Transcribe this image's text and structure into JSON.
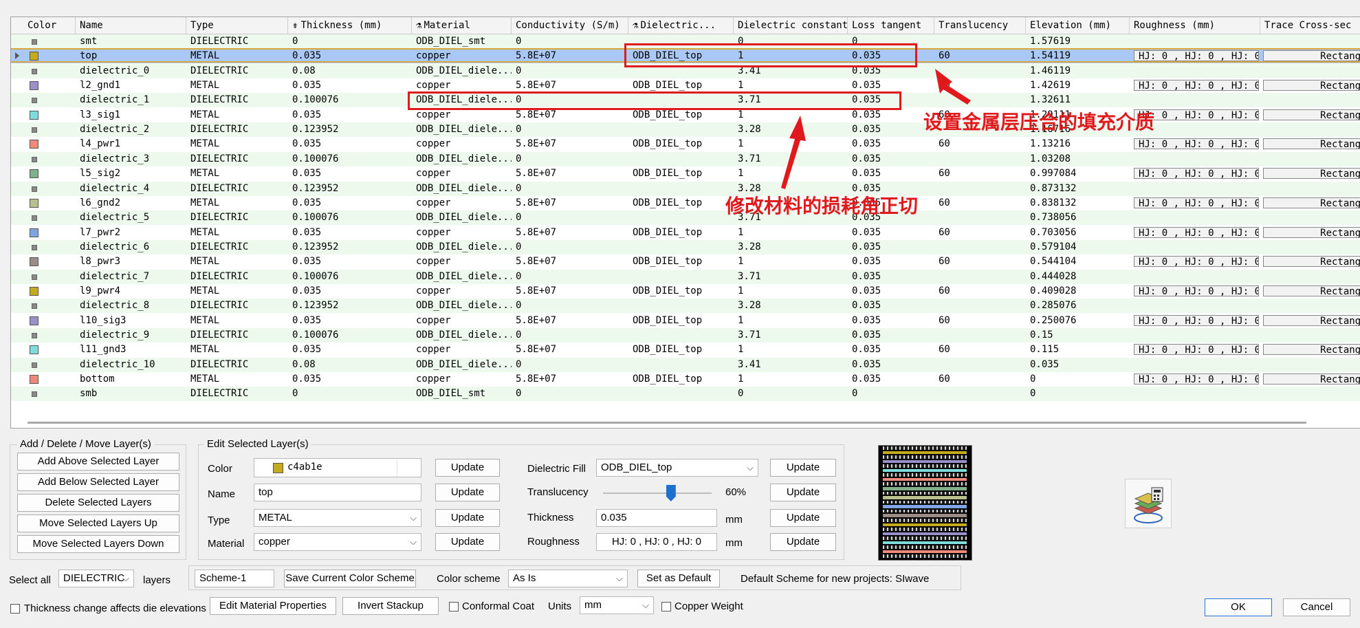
{
  "columns": [
    "Color",
    "Name",
    "Type",
    "Thickness (mm)",
    "Material",
    "Conductivity (S/m)",
    "Dielectric...",
    "Dielectric constant",
    "Loss tangent",
    "Translucency",
    "Elevation (mm)",
    "Roughness (mm)",
    "Trace Cross-sec"
  ],
  "rows": [
    {
      "color": "",
      "name": "smt",
      "type": "DIELECTRIC",
      "thickness": "0",
      "material": "ODB_DIEL_smt",
      "conductivity": "0",
      "fill": "",
      "dk": "0",
      "loss": "0",
      "transl": "",
      "elev": "1.57619",
      "rough": "",
      "trace": ""
    },
    {
      "color": "#c4ab1e",
      "name": "top",
      "type": "METAL",
      "thickness": "0.035",
      "material": "copper",
      "conductivity": "5.8E+07",
      "fill": "ODB_DIEL_top",
      "dk": "1",
      "loss": "0.035",
      "transl": "60",
      "elev": "1.54119",
      "rough": "HJ: 0 , HJ: 0 , HJ: 0",
      "trace": "Rectangle",
      "selected": true
    },
    {
      "color": "",
      "name": "dielectric_0",
      "type": "DIELECTRIC",
      "thickness": "0.08",
      "material": "ODB_DIEL_diele...",
      "conductivity": "0",
      "fill": "",
      "dk": "3.41",
      "loss": "0.035",
      "transl": "",
      "elev": "1.46119",
      "rough": "",
      "trace": ""
    },
    {
      "color": "#9b8fc9",
      "name": "l2_gnd1",
      "type": "METAL",
      "thickness": "0.035",
      "material": "copper",
      "conductivity": "5.8E+07",
      "fill": "ODB_DIEL_top",
      "dk": "1",
      "loss": "0.035",
      "transl": "60",
      "elev": "1.42619",
      "rough": "HJ: 0 , HJ: 0 , HJ: 0",
      "trace": "Rectangle"
    },
    {
      "color": "",
      "name": "dielectric_1",
      "type": "DIELECTRIC",
      "thickness": "0.100076",
      "material": "ODB_DIEL_diele...",
      "conductivity": "0",
      "fill": "",
      "dk": "3.71",
      "loss": "0.035",
      "transl": "",
      "elev": "1.32611",
      "rough": "",
      "trace": ""
    },
    {
      "color": "#7fdcdc",
      "name": "l3_sig1",
      "type": "METAL",
      "thickness": "0.035",
      "material": "copper",
      "conductivity": "5.8E+07",
      "fill": "ODB_DIEL_top",
      "dk": "1",
      "loss": "0.035",
      "transl": "60",
      "elev": "1.29111",
      "rough": "HJ: 0 , HJ: 0 , HJ: 0",
      "trace": "Rectangle"
    },
    {
      "color": "",
      "name": "dielectric_2",
      "type": "DIELECTRIC",
      "thickness": "0.123952",
      "material": "ODB_DIEL_diele...",
      "conductivity": "0",
      "fill": "",
      "dk": "3.28",
      "loss": "0.035",
      "transl": "",
      "elev": "1.16716",
      "rough": "",
      "trace": ""
    },
    {
      "color": "#ef8a7a",
      "name": "l4_pwr1",
      "type": "METAL",
      "thickness": "0.035",
      "material": "copper",
      "conductivity": "5.8E+07",
      "fill": "ODB_DIEL_top",
      "dk": "1",
      "loss": "0.035",
      "transl": "60",
      "elev": "1.13216",
      "rough": "HJ: 0 , HJ: 0 , HJ: 0",
      "trace": "Rectangle"
    },
    {
      "color": "",
      "name": "dielectric_3",
      "type": "DIELECTRIC",
      "thickness": "0.100076",
      "material": "ODB_DIEL_diele...",
      "conductivity": "0",
      "fill": "",
      "dk": "3.71",
      "loss": "0.035",
      "transl": "",
      "elev": "1.03208",
      "rough": "",
      "trace": ""
    },
    {
      "color": "#7fb08a",
      "name": "l5_sig2",
      "type": "METAL",
      "thickness": "0.035",
      "material": "copper",
      "conductivity": "5.8E+07",
      "fill": "ODB_DIEL_top",
      "dk": "1",
      "loss": "0.035",
      "transl": "60",
      "elev": "0.997084",
      "rough": "HJ: 0 , HJ: 0 , HJ: 0",
      "trace": "Rectangle"
    },
    {
      "color": "",
      "name": "dielectric_4",
      "type": "DIELECTRIC",
      "thickness": "0.123952",
      "material": "ODB_DIEL_diele...",
      "conductivity": "0",
      "fill": "",
      "dk": "3.28",
      "loss": "0.035",
      "transl": "",
      "elev": "0.873132",
      "rough": "",
      "trace": ""
    },
    {
      "color": "#b9c08e",
      "name": "l6_gnd2",
      "type": "METAL",
      "thickness": "0.035",
      "material": "copper",
      "conductivity": "5.8E+07",
      "fill": "ODB_DIEL_top",
      "dk": "1",
      "loss": "0.035",
      "transl": "60",
      "elev": "0.838132",
      "rough": "HJ: 0 , HJ: 0 , HJ: 0",
      "trace": "Rectangle"
    },
    {
      "color": "",
      "name": "dielectric_5",
      "type": "DIELECTRIC",
      "thickness": "0.100076",
      "material": "ODB_DIEL_diele...",
      "conductivity": "0",
      "fill": "",
      "dk": "3.71",
      "loss": "0.035",
      "transl": "",
      "elev": "0.738056",
      "rough": "",
      "trace": ""
    },
    {
      "color": "#7fa6e2",
      "name": "l7_pwr2",
      "type": "METAL",
      "thickness": "0.035",
      "material": "copper",
      "conductivity": "5.8E+07",
      "fill": "ODB_DIEL_top",
      "dk": "1",
      "loss": "0.035",
      "transl": "60",
      "elev": "0.703056",
      "rough": "HJ: 0 , HJ: 0 , HJ: 0",
      "trace": "Rectangle"
    },
    {
      "color": "",
      "name": "dielectric_6",
      "type": "DIELECTRIC",
      "thickness": "0.123952",
      "material": "ODB_DIEL_diele...",
      "conductivity": "0",
      "fill": "",
      "dk": "3.28",
      "loss": "0.035",
      "transl": "",
      "elev": "0.579104",
      "rough": "",
      "trace": ""
    },
    {
      "color": "#9c8c88",
      "name": "l8_pwr3",
      "type": "METAL",
      "thickness": "0.035",
      "material": "copper",
      "conductivity": "5.8E+07",
      "fill": "ODB_DIEL_top",
      "dk": "1",
      "loss": "0.035",
      "transl": "60",
      "elev": "0.544104",
      "rough": "HJ: 0 , HJ: 0 , HJ: 0",
      "trace": "Rectangle"
    },
    {
      "color": "",
      "name": "dielectric_7",
      "type": "DIELECTRIC",
      "thickness": "0.100076",
      "material": "ODB_DIEL_diele...",
      "conductivity": "0",
      "fill": "",
      "dk": "3.71",
      "loss": "0.035",
      "transl": "",
      "elev": "0.444028",
      "rough": "",
      "trace": ""
    },
    {
      "color": "#c4ab1e",
      "name": "l9_pwr4",
      "type": "METAL",
      "thickness": "0.035",
      "material": "copper",
      "conductivity": "5.8E+07",
      "fill": "ODB_DIEL_top",
      "dk": "1",
      "loss": "0.035",
      "transl": "60",
      "elev": "0.409028",
      "rough": "HJ: 0 , HJ: 0 , HJ: 0",
      "trace": "Rectangle"
    },
    {
      "color": "",
      "name": "dielectric_8",
      "type": "DIELECTRIC",
      "thickness": "0.123952",
      "material": "ODB_DIEL_diele...",
      "conductivity": "0",
      "fill": "",
      "dk": "3.28",
      "loss": "0.035",
      "transl": "",
      "elev": "0.285076",
      "rough": "",
      "trace": ""
    },
    {
      "color": "#9b8fc9",
      "name": "l10_sig3",
      "type": "METAL",
      "thickness": "0.035",
      "material": "copper",
      "conductivity": "5.8E+07",
      "fill": "ODB_DIEL_top",
      "dk": "1",
      "loss": "0.035",
      "transl": "60",
      "elev": "0.250076",
      "rough": "HJ: 0 , HJ: 0 , HJ: 0",
      "trace": "Rectangle"
    },
    {
      "color": "",
      "name": "dielectric_9",
      "type": "DIELECTRIC",
      "thickness": "0.100076",
      "material": "ODB_DIEL_diele...",
      "conductivity": "0",
      "fill": "",
      "dk": "3.71",
      "loss": "0.035",
      "transl": "",
      "elev": "0.15",
      "rough": "",
      "trace": ""
    },
    {
      "color": "#7fdcdc",
      "name": "l11_gnd3",
      "type": "METAL",
      "thickness": "0.035",
      "material": "copper",
      "conductivity": "5.8E+07",
      "fill": "ODB_DIEL_top",
      "dk": "1",
      "loss": "0.035",
      "transl": "60",
      "elev": "0.115",
      "rough": "HJ: 0 , HJ: 0 , HJ: 0",
      "trace": "Rectangle"
    },
    {
      "color": "",
      "name": "dielectric_10",
      "type": "DIELECTRIC",
      "thickness": "0.08",
      "material": "ODB_DIEL_diele...",
      "conductivity": "0",
      "fill": "",
      "dk": "3.41",
      "loss": "0.035",
      "transl": "",
      "elev": "0.035",
      "rough": "",
      "trace": ""
    },
    {
      "color": "#ef8a7a",
      "name": "bottom",
      "type": "METAL",
      "thickness": "0.035",
      "material": "copper",
      "conductivity": "5.8E+07",
      "fill": "ODB_DIEL_top",
      "dk": "1",
      "loss": "0.035",
      "transl": "60",
      "elev": "0",
      "rough": "HJ: 0 , HJ: 0 , HJ: 0",
      "trace": "Rectangle"
    },
    {
      "color": "",
      "name": "smb",
      "type": "DIELECTRIC",
      "thickness": "0",
      "material": "ODB_DIEL_smt",
      "conductivity": "0",
      "fill": "",
      "dk": "0",
      "loss": "0",
      "transl": "",
      "elev": "0",
      "rough": "",
      "trace": ""
    }
  ],
  "annotations": {
    "fill_note": "设置金属层压合的填充介质",
    "loss_note": "修改材料的损耗角正切"
  },
  "add_group": {
    "title": "Add / Delete / Move Layer(s)",
    "buttons": [
      "Add Above Selected Layer",
      "Add Below Selected Layer",
      "Delete Selected Layers",
      "Move Selected Layers Up",
      "Move Selected Layers Down"
    ]
  },
  "edit_group": {
    "title": "Edit Selected Layer(s)",
    "color_label": "Color",
    "color_value": "c4ab1e",
    "name_label": "Name",
    "name_value": "top",
    "type_label": "Type",
    "type_value": "METAL",
    "material_label": "Material",
    "material_value": "copper",
    "update": "Update",
    "fill_label": "Dielectric Fill",
    "fill_value": "ODB_DIEL_top",
    "transl_label": "Translucency",
    "transl_value": "60%",
    "transl_level": 0.6,
    "thickness_label": "Thickness",
    "thickness_value": "0.035",
    "unit_mm": "mm",
    "rough_label": "Roughness",
    "rough_value": "HJ: 0 , HJ: 0 , HJ: 0"
  },
  "scheme_bar": {
    "select_all": "Select all",
    "select_value": "DIELECTRIC",
    "layers": "layers",
    "scheme_name": "Scheme-1",
    "save_scheme": "Save Current Color Scheme",
    "color_scheme_label": "Color scheme",
    "color_scheme_value": "As Is",
    "set_default": "Set as Default",
    "default_note": "Default Scheme for new projects: SIwave"
  },
  "footer": {
    "thickness_change": "Thickness change affects die elevations",
    "edit_material": "Edit Material Properties",
    "invert": "Invert Stackup",
    "conformal": "Conformal Coat",
    "units_label": "Units",
    "units_value": "mm",
    "copper_weight": "Copper Weight",
    "ok": "OK",
    "cancel": "Cancel"
  },
  "colors": {
    "accent": "#e0191c",
    "selected_row": "#a9c8f5",
    "alt_row": "#eef9ee"
  }
}
